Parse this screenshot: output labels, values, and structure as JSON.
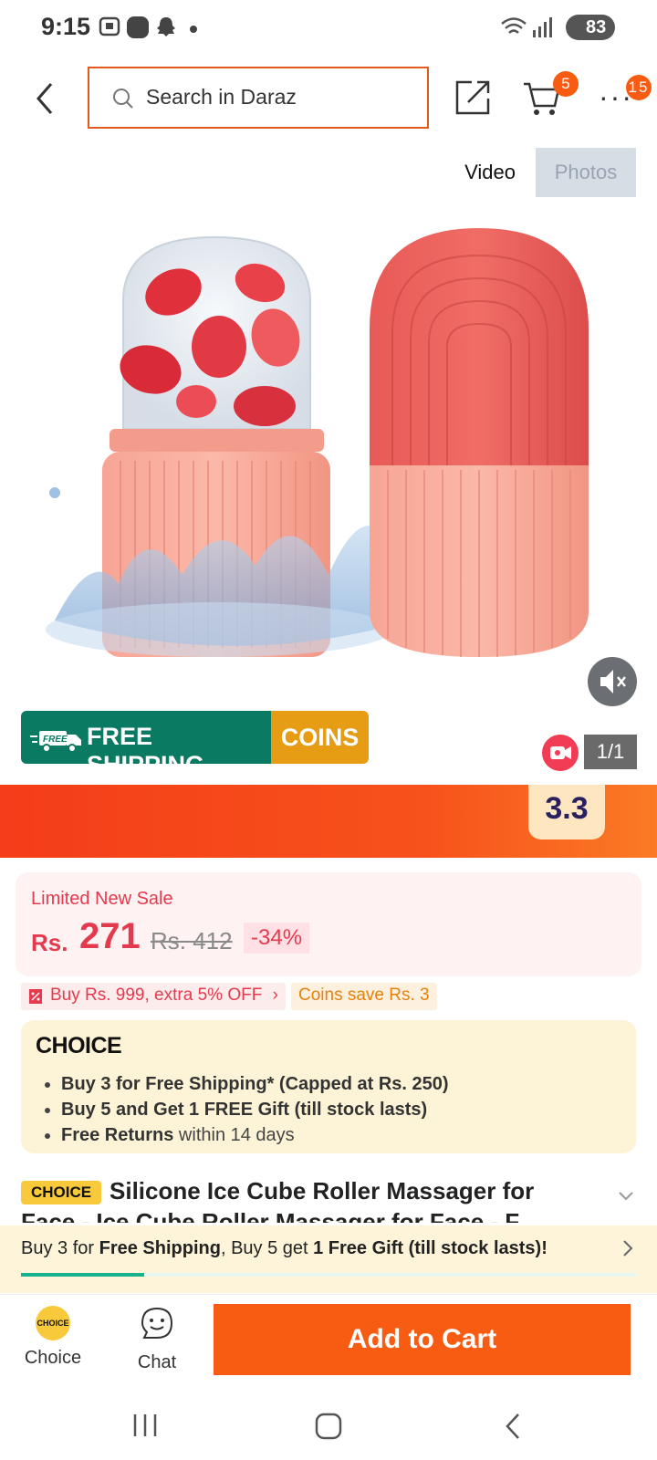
{
  "status_bar": {
    "time": "9:15",
    "battery": "83"
  },
  "header": {
    "search_placeholder": "Search in Daraz",
    "cart_badge": "5",
    "more_badge": "15"
  },
  "media_tabs": {
    "video": "Video",
    "photos": "Photos"
  },
  "gallery": {
    "counter": "1/1"
  },
  "free_shipping_banner": {
    "free_tag": "FREE",
    "label": "FREE SHIPPING",
    "coins": "COINS"
  },
  "promo": {
    "badge": "3.3"
  },
  "price": {
    "title": "Limited New Sale",
    "currency": "Rs.",
    "amount": "271",
    "original": "Rs. 412",
    "discount": "-34%"
  },
  "voucher": {
    "text": "Buy Rs. 999, extra 5% OFF",
    "coins_save": "Coins save Rs. 3"
  },
  "choice": {
    "logo": "CHOICE",
    "benefits": [
      {
        "bold": "Buy 3 for  Free Shipping* (Capped at Rs. 250)",
        "rest": ""
      },
      {
        "bold": "Buy 5 and Get 1 FREE Gift (till stock lasts)",
        "rest": ""
      },
      {
        "bold": "Free Returns",
        "rest": " within 14 days"
      }
    ]
  },
  "product": {
    "tag": "CHOICE",
    "title_line1": "Silicone Ice Cube Roller Massager for",
    "title_line2": "Face - Ice Cube Roller Massager for Face - F"
  },
  "bundle_bar": {
    "part1": "Buy 3 for ",
    "part2": "Free Shipping",
    "part3": ", Buy 5 get ",
    "part4": "1 Free Gift (till stock lasts)!",
    "progress": 0.2
  },
  "actions": {
    "choice_label": "Choice",
    "choice_icon_text": "CHOICE",
    "chat_label": "Chat",
    "add_to_cart": "Add to Cart"
  },
  "colors": {
    "accent": "#f85c12",
    "price_red": "#e53a4e",
    "choice_yellow": "#f8c93a",
    "free_ship_green": "#0b7a62",
    "coins_orange": "#e79d13"
  }
}
